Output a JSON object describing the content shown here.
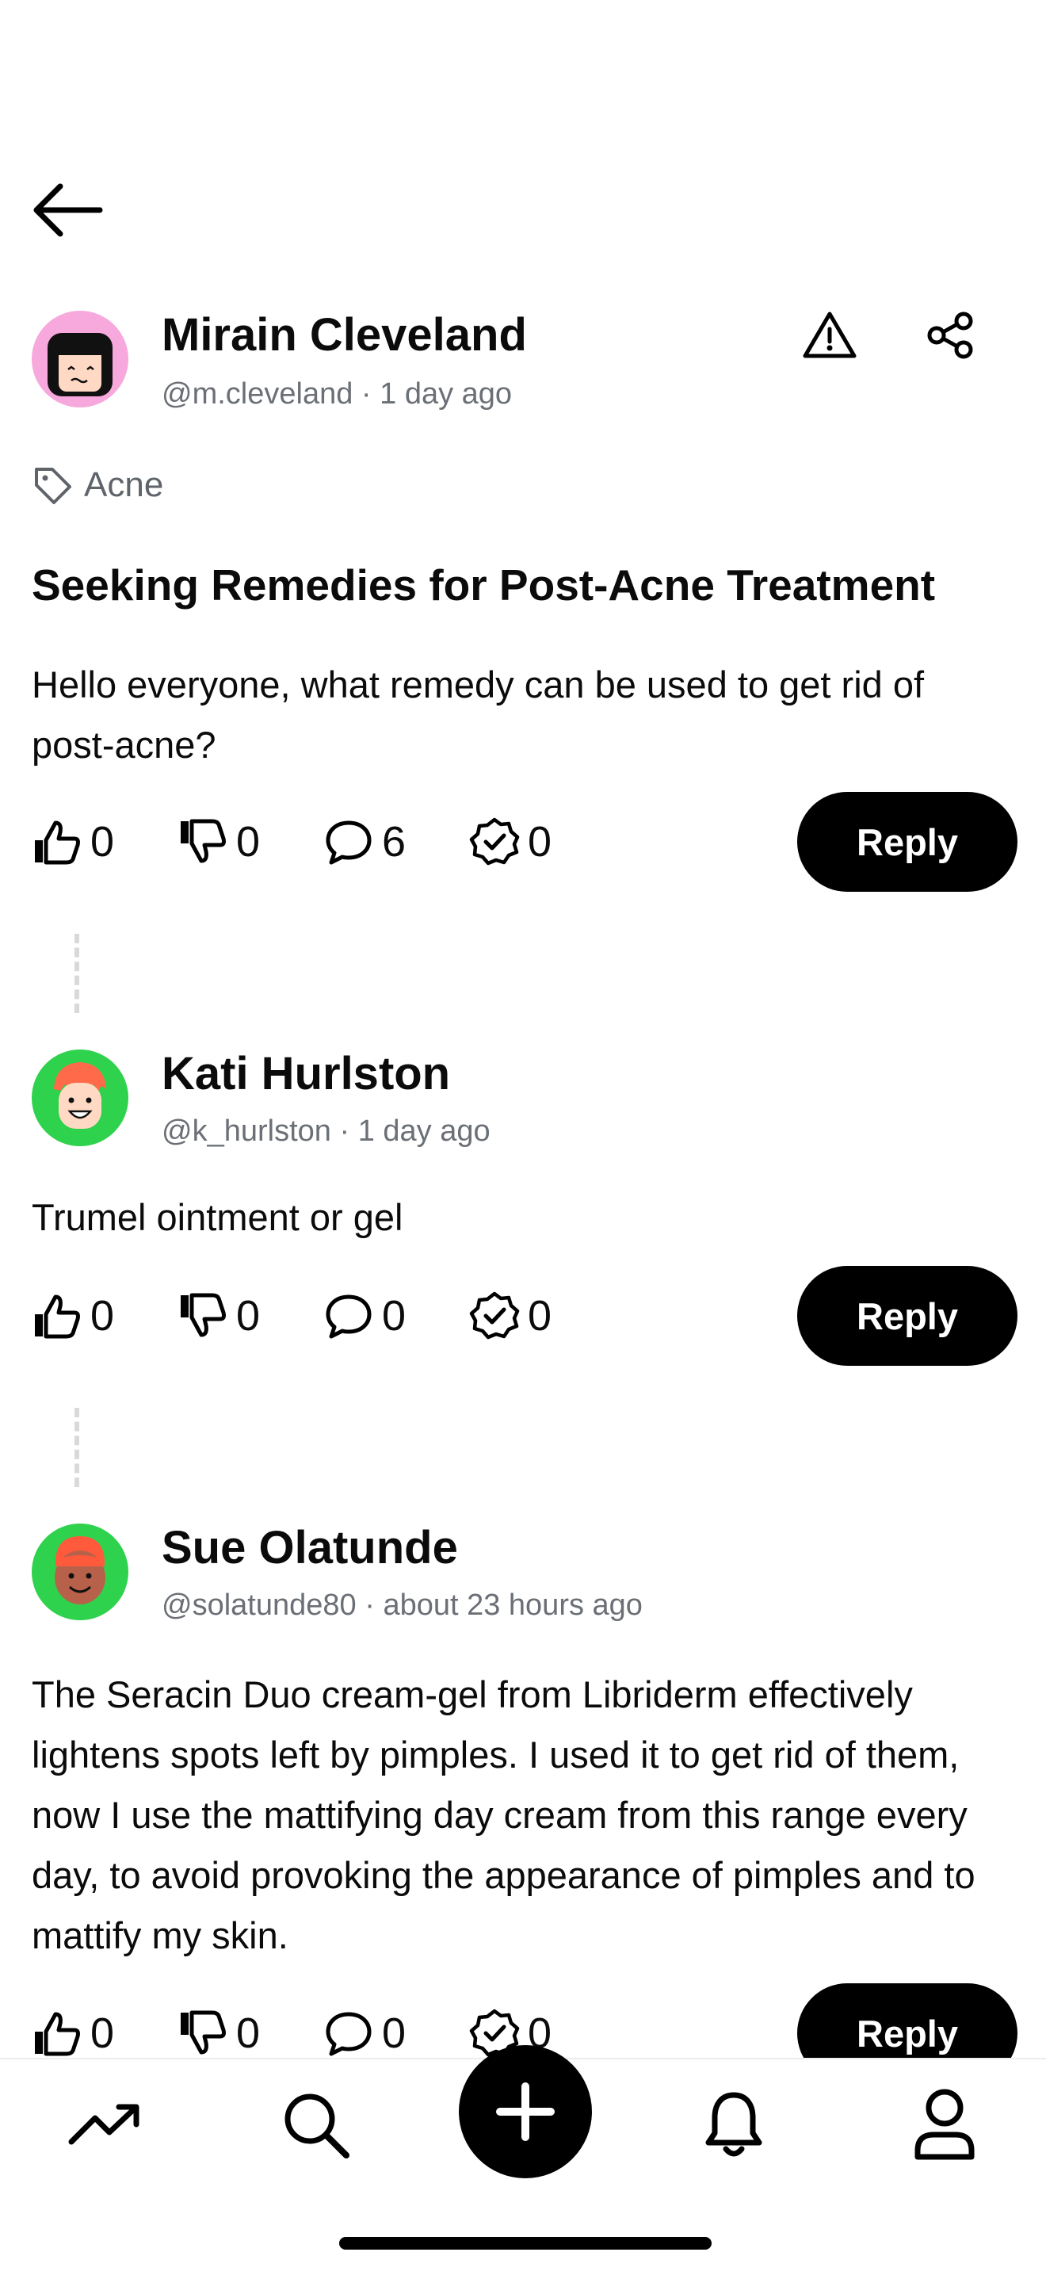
{
  "post": {
    "author": {
      "name": "Mirain Cleveland",
      "handle": "@m.cleveland",
      "time": "1 day ago",
      "sep": " · "
    },
    "tag": "Acne",
    "title": "Seeking Remedies for Post-Acne Treatment",
    "body": "Hello everyone, what remedy can be used to get rid of post-acne?",
    "likes": "0",
    "dislikes": "0",
    "comments": "6",
    "verified": "0",
    "reply_label": "Reply"
  },
  "replies": [
    {
      "author": {
        "name": "Kati Hurlston",
        "handle": "@k_hurlston",
        "time": "1 day ago",
        "sep": " · "
      },
      "body": "Trumel ointment or gel",
      "likes": "0",
      "dislikes": "0",
      "comments": "0",
      "verified": "0",
      "reply_label": "Reply"
    },
    {
      "author": {
        "name": "Sue Olatunde",
        "handle": "@solatunde80",
        "time": "about 23 hours ago",
        "sep": " · "
      },
      "body": "The Seracin Duo cream-gel from Libriderm effectively lightens spots left by pimples. I used it to get rid of them, now I use the mattifying day cream from this range every day, to avoid provoking the appearance of pimples and to mattify my skin.",
      "likes": "0",
      "dislikes": "0",
      "comments": "0",
      "verified": "0",
      "reply_label": "Reply"
    }
  ],
  "icons": {
    "back": "arrow-left-icon",
    "report": "warning-icon",
    "share": "share-icon",
    "tag": "tag-icon",
    "like": "thumbs-up-icon",
    "dislike": "thumbs-down-icon",
    "comment": "comment-icon",
    "verified": "verified-badge-icon",
    "nav": [
      "trending-icon",
      "search-icon",
      "plus-icon",
      "bell-icon",
      "profile-icon"
    ]
  },
  "colors": {
    "avatar1_bg": "#f7a8dc",
    "avatar2_bg": "#2fd24c",
    "avatar3_bg": "#2fd24c",
    "button_bg": "#000000",
    "meta_text": "#6b6f76"
  }
}
